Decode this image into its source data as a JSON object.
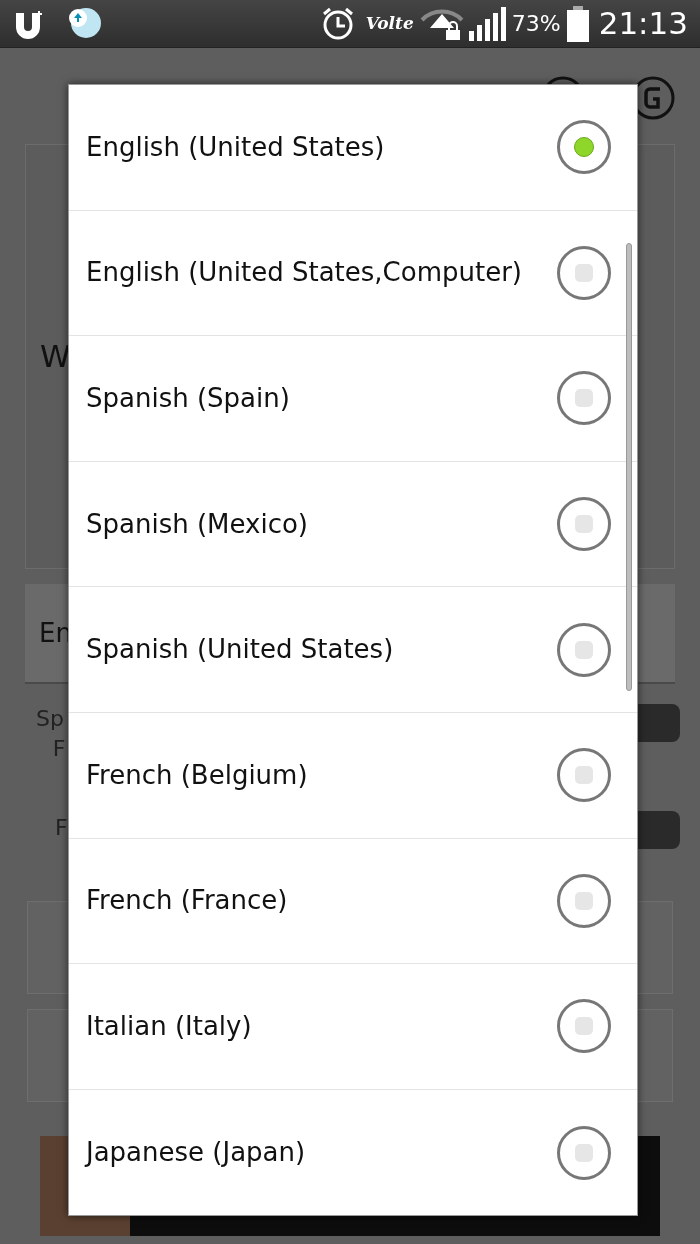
{
  "status_bar": {
    "network": "Volte",
    "battery": "73%",
    "time": "21:13"
  },
  "background": {
    "panel_text": "W",
    "dropdown_text": "En",
    "label_1": "Sp",
    "label_1_line_2": "F",
    "label_2": "F"
  },
  "dialog": {
    "options": [
      {
        "label": "English (United States)",
        "selected": true
      },
      {
        "label": "English (United States,Computer)",
        "selected": false
      },
      {
        "label": "Spanish (Spain)",
        "selected": false
      },
      {
        "label": "Spanish (Mexico)",
        "selected": false
      },
      {
        "label": "Spanish (United States)",
        "selected": false
      },
      {
        "label": "French (Belgium)",
        "selected": false
      },
      {
        "label": "French (France)",
        "selected": false
      },
      {
        "label": "Italian (Italy)",
        "selected": false
      },
      {
        "label": "Japanese (Japan)",
        "selected": false
      }
    ]
  }
}
